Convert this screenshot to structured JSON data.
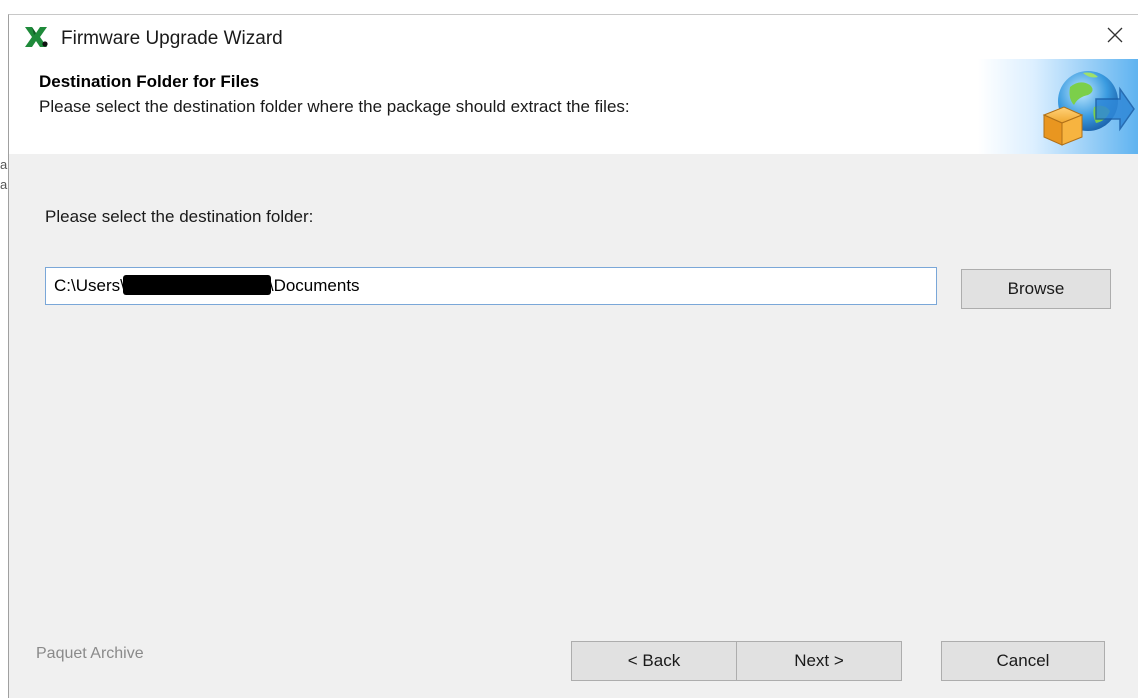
{
  "window": {
    "title": "Firmware Upgrade Wizard",
    "app_icon": "green-x-icon",
    "close_icon": "close-icon"
  },
  "background_fragments": [
    "a",
    "a"
  ],
  "header": {
    "title": "Destination Folder for Files",
    "subtitle": "Please select the destination folder where the package should extract the files:",
    "graphic_icon": "globe-package-icon"
  },
  "content": {
    "label": "Please select the destination folder:",
    "path_prefix": "C:\\Users\\",
    "path_suffix": "\\Documents",
    "browse_label": "Browse"
  },
  "footer": {
    "label": "Paquet Archive",
    "back_label": "< Back",
    "next_label": "Next >",
    "cancel_label": "Cancel"
  },
  "colors": {
    "dialog_bg": "#f0f0f0",
    "input_border": "#7aa7d8",
    "button_bg": "#e1e1e1",
    "icon_green": "#1e8a3a"
  }
}
